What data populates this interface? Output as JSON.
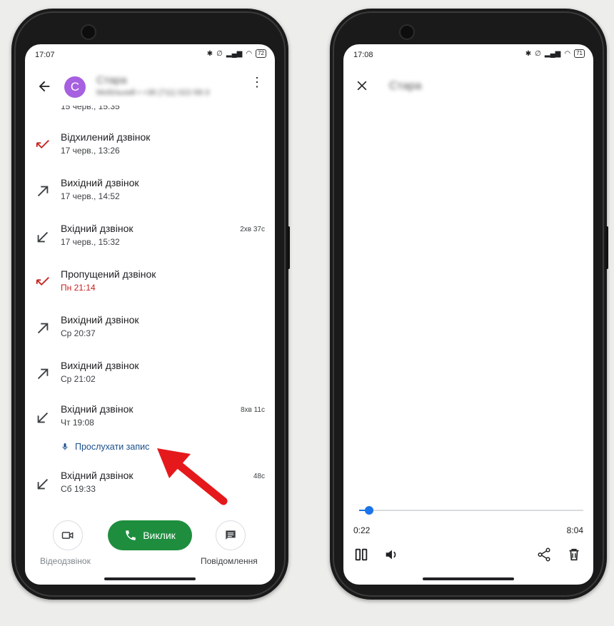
{
  "left_screen": {
    "status": {
      "time": "17:07",
      "battery": "72"
    },
    "contact": {
      "initial": "C",
      "name": "Стара",
      "detail": "Мобільний • +38 (711) 022-58-3"
    },
    "partial_row_time": "15 черв., 15:35",
    "calls": [
      {
        "type": "declined",
        "title": "Відхилений дзвінок",
        "time": "17 черв., 13:26",
        "duration": ""
      },
      {
        "type": "outgoing",
        "title": "Вихідний дзвінок",
        "time": "17 черв., 14:52",
        "duration": ""
      },
      {
        "type": "incoming",
        "title": "Вхідний дзвінок",
        "time": "17 черв., 15:32",
        "duration": "2хв 37с"
      },
      {
        "type": "missed",
        "title": "Пропущений дзвінок",
        "time": "Пн 21:14",
        "duration": ""
      },
      {
        "type": "outgoing",
        "title": "Вихідний дзвінок",
        "time": "Ср 20:37",
        "duration": ""
      },
      {
        "type": "outgoing",
        "title": "Вихідний дзвінок",
        "time": "Ср 21:02",
        "duration": ""
      },
      {
        "type": "incoming",
        "title": "Вхідний дзвінок",
        "time": "Чт 19:08",
        "duration": "8хв 11с"
      },
      {
        "type": "incoming",
        "title": "Вхідний дзвінок",
        "time": "Сб 19:33",
        "duration": "48с"
      }
    ],
    "listen_label": "Прослухати запис",
    "bottom": {
      "video_label": "Відеодзвінок",
      "call_label": "Виклик",
      "message_label": "Повідомлення"
    }
  },
  "right_screen": {
    "status": {
      "time": "17:08",
      "battery": "71"
    },
    "title": "Стара",
    "player": {
      "current": "0:22",
      "total": "8:04",
      "progress": 0.045
    }
  },
  "colors": {
    "accent": "#1a73e8",
    "call_green": "#1e8e3e",
    "missed_red": "#c5221f",
    "avatar": "#a660e0",
    "arrow": "#e5191b"
  }
}
